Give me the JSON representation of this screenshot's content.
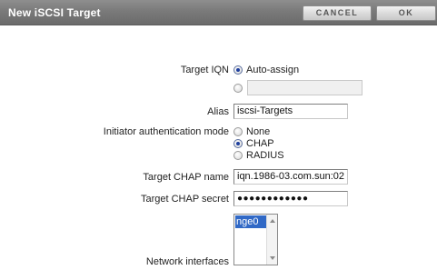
{
  "dialog": {
    "title": "New iSCSI Target",
    "cancel_label": "CANCEL",
    "ok_label": "OK"
  },
  "form": {
    "target_iqn": {
      "label": "Target IQN",
      "auto_option": "Auto-assign",
      "auto_selected": true,
      "manual_value": ""
    },
    "alias": {
      "label": "Alias",
      "value": "iscsi-Targets"
    },
    "auth_mode": {
      "label": "Initiator authentication mode",
      "options": [
        "None",
        "CHAP",
        "RADIUS"
      ],
      "selected": "CHAP"
    },
    "chap_name": {
      "label": "Target CHAP name",
      "value": "iqn.1986-03.com.sun:02"
    },
    "chap_secret": {
      "label": "Target CHAP secret",
      "value": "●●●●●●●●●●●●"
    },
    "network_interfaces": {
      "label": "Network interfaces",
      "items": [
        "nge0"
      ],
      "selected": "nge0"
    }
  },
  "colors": {
    "titlebar": "#7a7a7a",
    "selection": "#3169c6",
    "radio_dot": "#1e3f9e"
  }
}
